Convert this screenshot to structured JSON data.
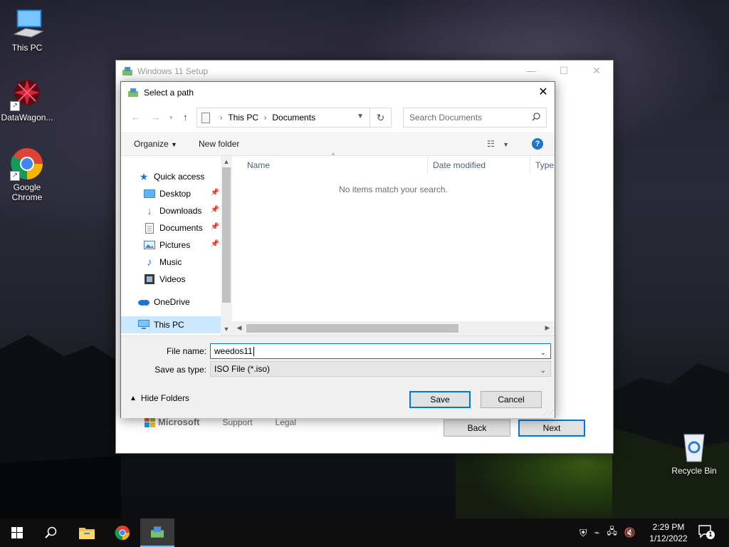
{
  "desktop": {
    "icons": [
      {
        "label": "This PC"
      },
      {
        "label": "DataWagon..."
      },
      {
        "label": "Google\nChrome"
      },
      {
        "label": "Recycle Bin"
      }
    ]
  },
  "setup_window": {
    "title": "Windows 11 Setup",
    "footer": {
      "brand": "Microsoft",
      "support": "Support",
      "legal": "Legal"
    },
    "back_label": "Back",
    "next_label": "Next"
  },
  "dialog": {
    "title": "Select a path",
    "breadcrumb": [
      "This PC",
      "Documents"
    ],
    "search_placeholder": "Search Documents",
    "toolbar": {
      "organize": "Organize",
      "new_folder": "New folder"
    },
    "nav_items": [
      {
        "label": "Quick access",
        "icon": "star-icon",
        "pinned": false,
        "selected": false
      },
      {
        "label": "Desktop",
        "icon": "desktop-folder-icon",
        "pinned": true,
        "selected": false
      },
      {
        "label": "Downloads",
        "icon": "download-icon",
        "pinned": true,
        "selected": false
      },
      {
        "label": "Documents",
        "icon": "document-icon",
        "pinned": true,
        "selected": false
      },
      {
        "label": "Pictures",
        "icon": "pictures-icon",
        "pinned": true,
        "selected": false
      },
      {
        "label": "Music",
        "icon": "music-icon",
        "pinned": false,
        "selected": false
      },
      {
        "label": "Videos",
        "icon": "videos-icon",
        "pinned": false,
        "selected": false
      },
      {
        "label": "OneDrive",
        "icon": "onedrive-icon",
        "pinned": false,
        "selected": false
      },
      {
        "label": "This PC",
        "icon": "computer-icon",
        "pinned": false,
        "selected": true
      }
    ],
    "columns": [
      "Name",
      "Date modified",
      "Type"
    ],
    "empty_message": "No items match your search.",
    "file_name_label": "File name:",
    "file_name_value": "weedos11",
    "save_type_label": "Save as type:",
    "save_type_value": "ISO File (*.iso)",
    "hide_folders_label": "Hide Folders",
    "save_label": "Save",
    "cancel_label": "Cancel"
  },
  "taskbar": {
    "time": "2:29 PM",
    "date": "1/12/2022",
    "notification_count": "1"
  },
  "colors": {
    "accent": "#0078d7",
    "selection": "#cce8ff"
  }
}
